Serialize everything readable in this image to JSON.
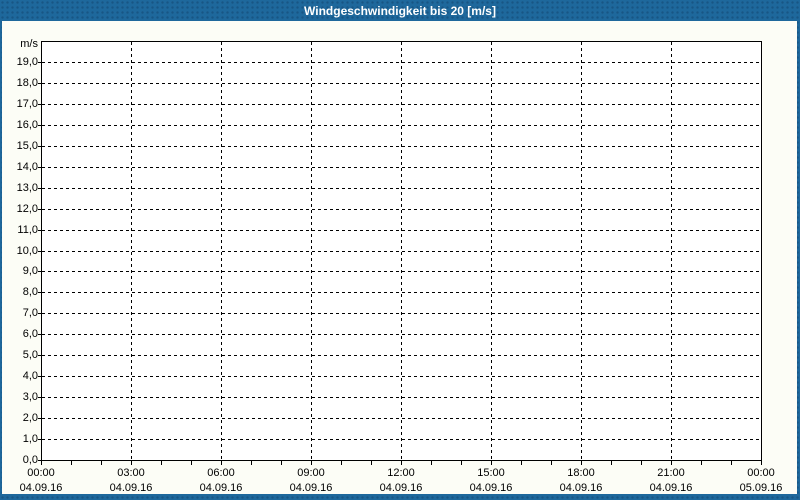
{
  "window": {
    "title": "Windgeschwindigkeit bis 20 [m/s]"
  },
  "colors": {
    "frame_blue": "#1e689c",
    "frame_dots": "#145a8a",
    "content_bg": "#fcfdf6",
    "plot_bg": "#ffffff",
    "grid": "#000000",
    "axis": "#000000",
    "label_text": "#000000",
    "title_text": "#ffffff"
  },
  "chart_data": {
    "type": "line",
    "title": "Windgeschwindigkeit bis 20 [m/s]",
    "ylabel": "m/s",
    "xlabel": "",
    "ylim": [
      0,
      20
    ],
    "ytick_interval": 1,
    "y_tick_labels": [
      "0,0",
      "1,0",
      "2,0",
      "3,0",
      "4,0",
      "5,0",
      "6,0",
      "7,0",
      "8,0",
      "9,0",
      "10,0",
      "11,0",
      "12,0",
      "13,0",
      "14,0",
      "15,0",
      "16,0",
      "17,0",
      "18,0",
      "19,0"
    ],
    "x_axis": {
      "major_tick_hours": 3,
      "minor_tick_hours": 1,
      "total_hours": 24,
      "ticks": [
        {
          "time": "00:00",
          "date": "04.09.16"
        },
        {
          "time": "03:00",
          "date": "04.09.16"
        },
        {
          "time": "06:00",
          "date": "04.09.16"
        },
        {
          "time": "09:00",
          "date": "04.09.16"
        },
        {
          "time": "12:00",
          "date": "04.09.16"
        },
        {
          "time": "15:00",
          "date": "04.09.16"
        },
        {
          "time": "18:00",
          "date": "04.09.16"
        },
        {
          "time": "21:00",
          "date": "04.09.16"
        },
        {
          "time": "00:00",
          "date": "05.09.16"
        }
      ]
    },
    "grid": {
      "horizontal": "dashed",
      "vertical_major": "dashed"
    },
    "legend": "none",
    "series": []
  }
}
